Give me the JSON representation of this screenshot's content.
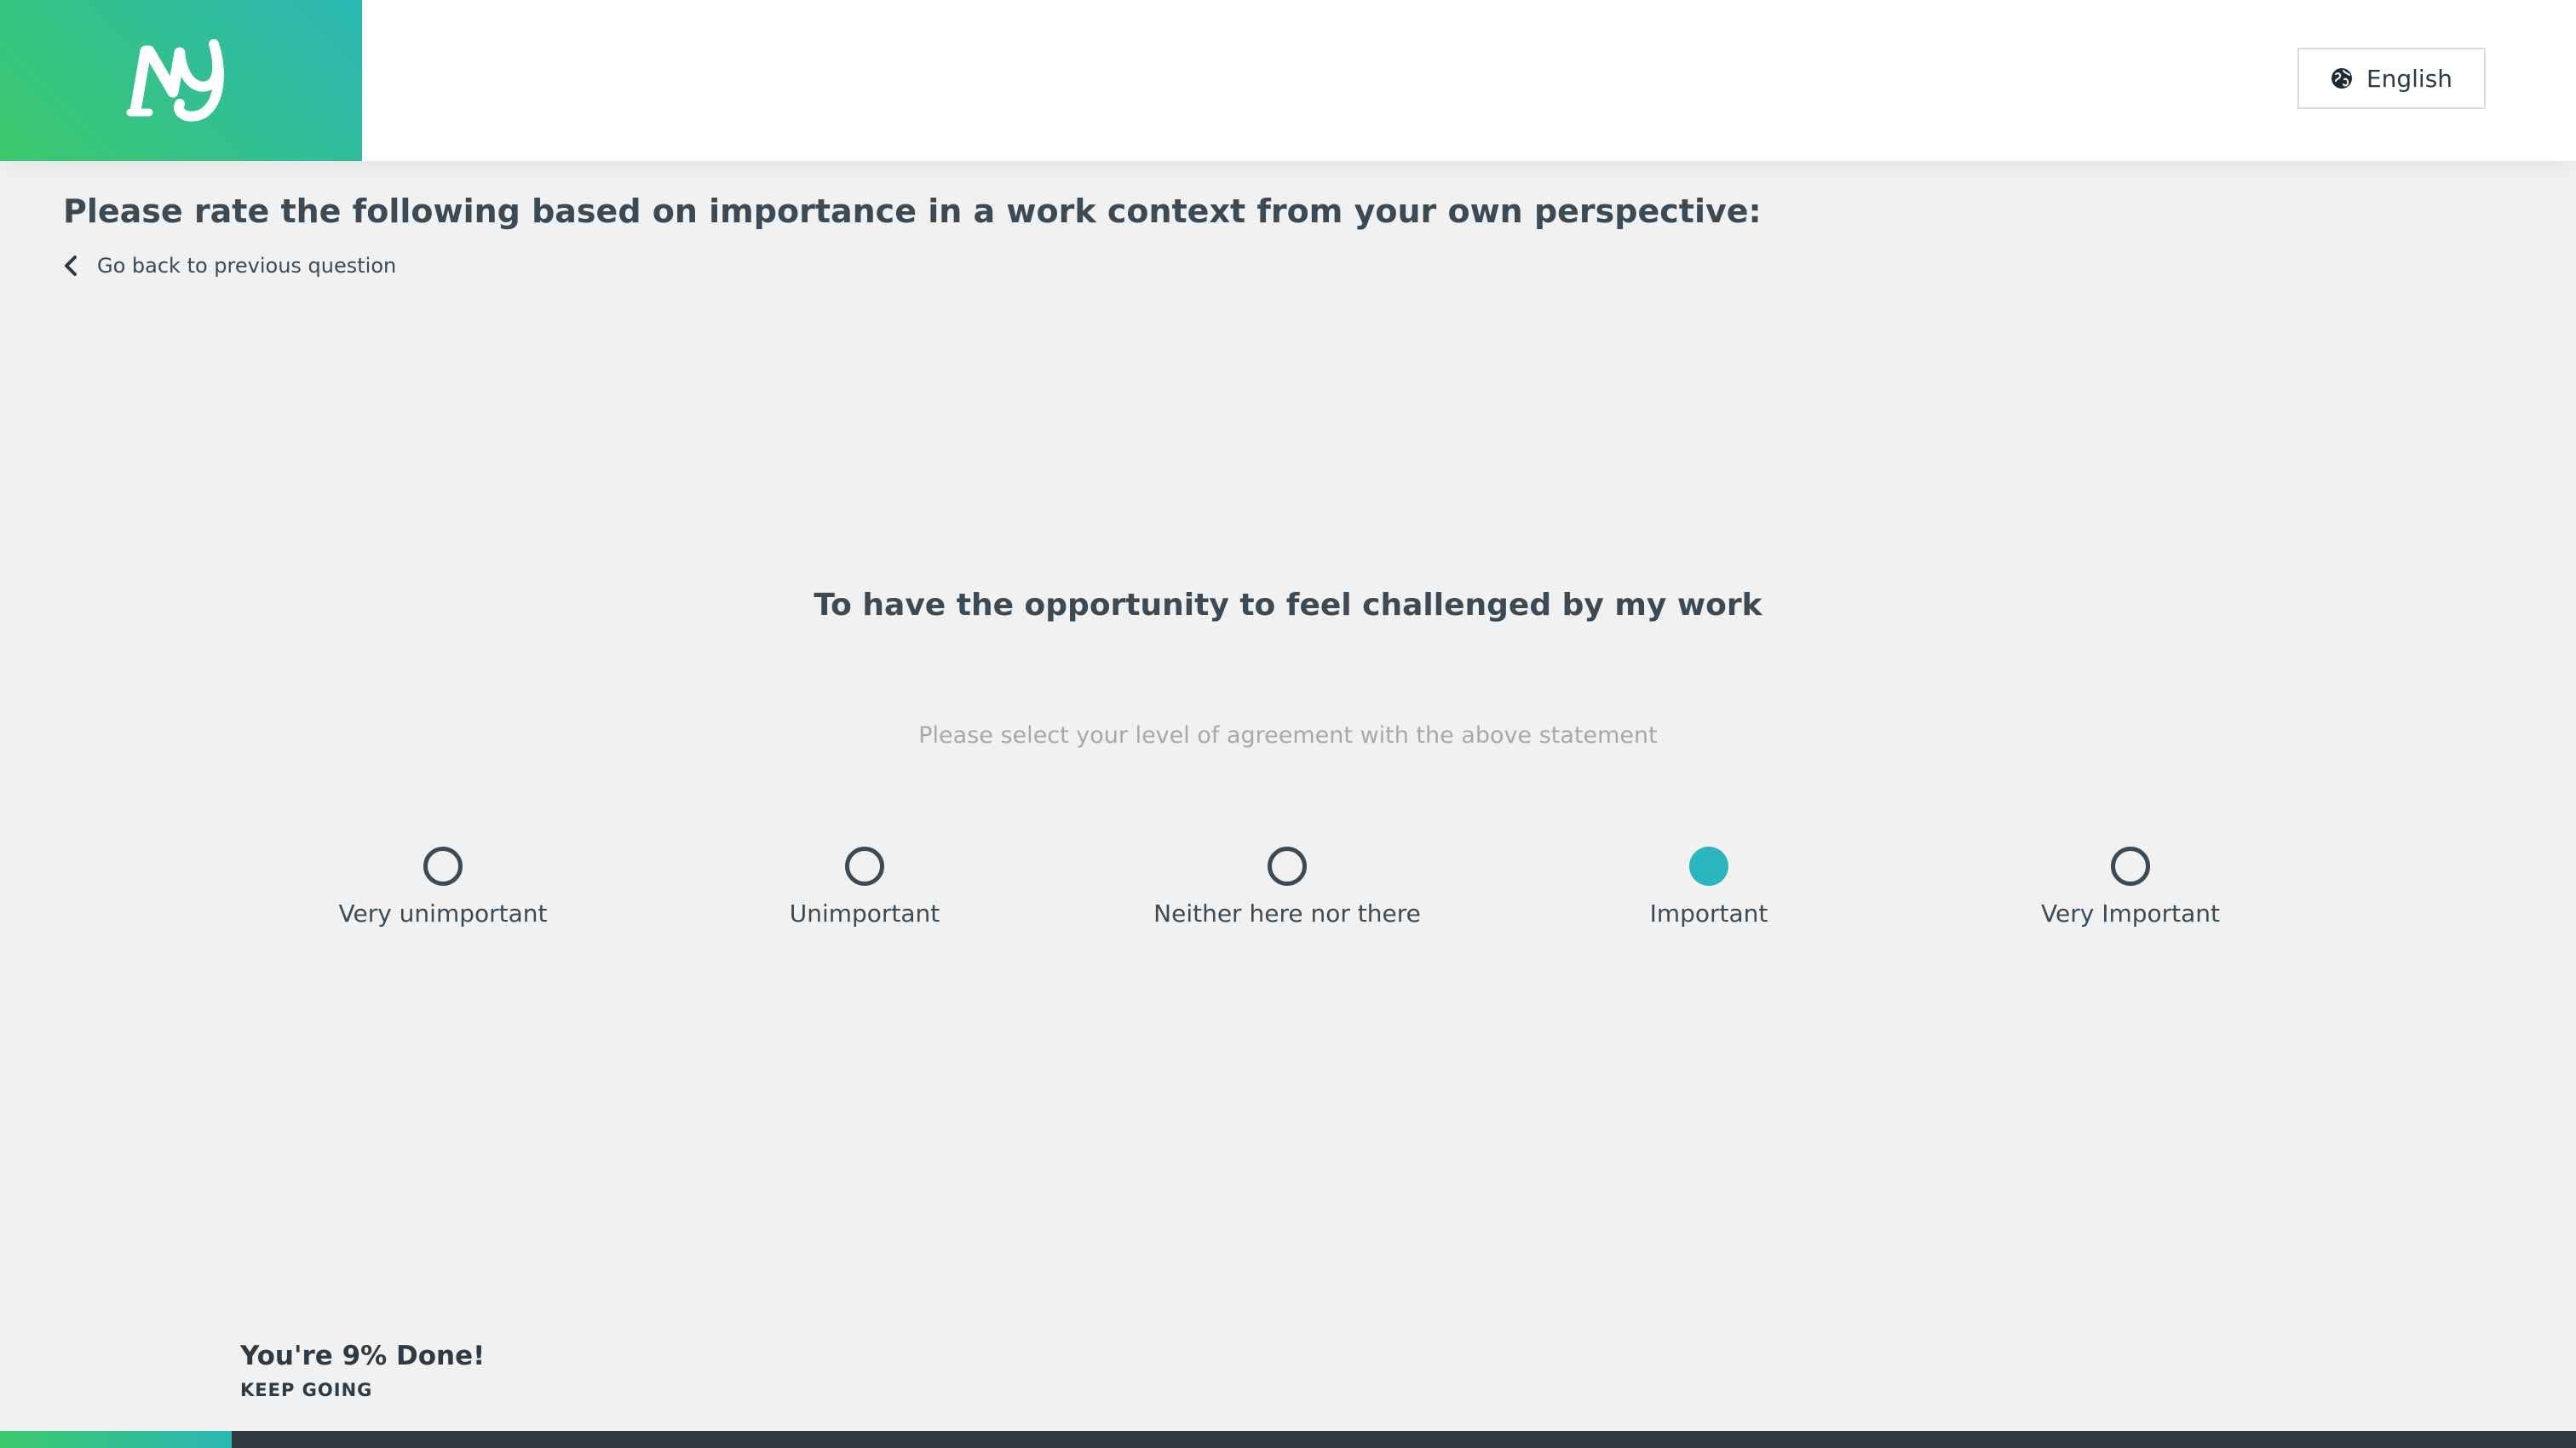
{
  "header": {
    "logo_text": "NY",
    "language_label": "English"
  },
  "question": {
    "prompt": "Please rate the following based on importance in a work context from your own perspective:",
    "back_label": "Go back to previous question",
    "statement": "To have the opportunity to feel challenged by my work",
    "instruction": "Please select your level of agreement with the above statement"
  },
  "options": [
    {
      "label": "Very unimportant",
      "selected": false
    },
    {
      "label": "Unimportant",
      "selected": false
    },
    {
      "label": "Neither here nor there",
      "selected": false
    },
    {
      "label": "Important",
      "selected": true
    },
    {
      "label": "Very Important",
      "selected": false
    }
  ],
  "progress": {
    "title": "You're 9% Done!",
    "subtitle": "KEEP GOING",
    "percent": 9
  },
  "colors": {
    "brand_green": "#3cc96b",
    "brand_teal": "#2ab7b4",
    "selected_radio": "#2ab5bf",
    "text_dark": "#3c4a55"
  }
}
